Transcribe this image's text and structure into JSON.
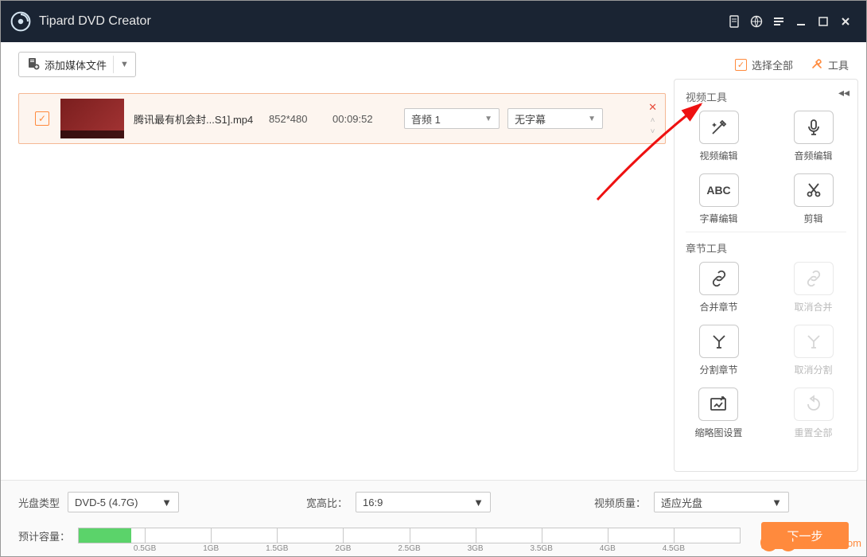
{
  "app": {
    "title": "Tipard DVD Creator"
  },
  "toolbar": {
    "add_media": "添加媒体文件",
    "select_all": "选择全部",
    "tools": "工具"
  },
  "media_row": {
    "filename": "腾讯最有机会封...S1].mp4",
    "resolution": "852*480",
    "duration": "00:09:52",
    "audio_selected": "音频 1",
    "subtitle_selected": "无字幕"
  },
  "panel": {
    "video_section": "视频工具",
    "chapter_section": "章节工具",
    "tools": {
      "video_edit": "视频编辑",
      "audio_edit": "音频编辑",
      "subtitle_edit": "字幕编辑",
      "trim": "剪辑",
      "merge_chapter": "合并章节",
      "unmerge_chapter": "取消合并",
      "split_chapter": "分割章节",
      "unsplit_chapter": "取消分割",
      "thumbnail": "缩略图设置",
      "reset_all": "重置全部"
    }
  },
  "bottom": {
    "disc_type_label": "光盘类型",
    "disc_type_value": "DVD-5 (4.7G)",
    "aspect_label": "宽高比：",
    "aspect_value": "16:9",
    "quality_label": "视频质量：",
    "quality_value": "适应光盘",
    "capacity_label": "预计容量：",
    "ticks": [
      "0.5GB",
      "1GB",
      "1.5GB",
      "2GB",
      "2.5GB",
      "3GB",
      "3.5GB",
      "4GB",
      "4.5GB"
    ],
    "next": "下一步"
  },
  "watermark": "danji100.com"
}
